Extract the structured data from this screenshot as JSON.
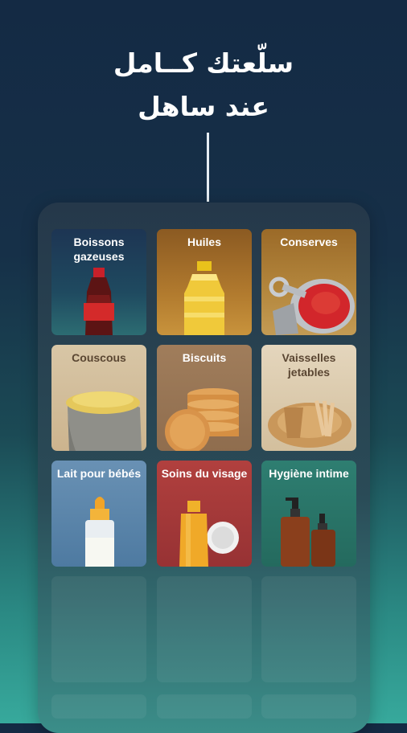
{
  "headline": {
    "line1": "سلّعتك كــامل",
    "line2": "عند ساهل"
  },
  "categories": [
    {
      "label": "Boissons gazeuses",
      "icon": "soda-bottle-icon",
      "color": "#1f3b58"
    },
    {
      "label": "Huiles",
      "icon": "oil-bottle-icon",
      "color": "#a26b25"
    },
    {
      "label": "Conserves",
      "icon": "tin-can-icon",
      "color": "#a8782f"
    },
    {
      "label": "Couscous",
      "icon": "couscous-sack-icon",
      "color": "#d7c3a0"
    },
    {
      "label": "Biscuits",
      "icon": "biscuits-stack-icon",
      "color": "#9c7a59"
    },
    {
      "label": "Vaisselles jetables",
      "icon": "disposable-tableware-icon",
      "color": "#e0d0b5"
    },
    {
      "label": "Lait pour bébés",
      "icon": "baby-bottle-icon",
      "color": "#5f86aa"
    },
    {
      "label": "Soins du visage",
      "icon": "face-care-bottle-icon",
      "color": "#a93a3c"
    },
    {
      "label": "Hygiène intime",
      "icon": "soap-dispenser-icon",
      "color": "#2b7a6d"
    }
  ]
}
